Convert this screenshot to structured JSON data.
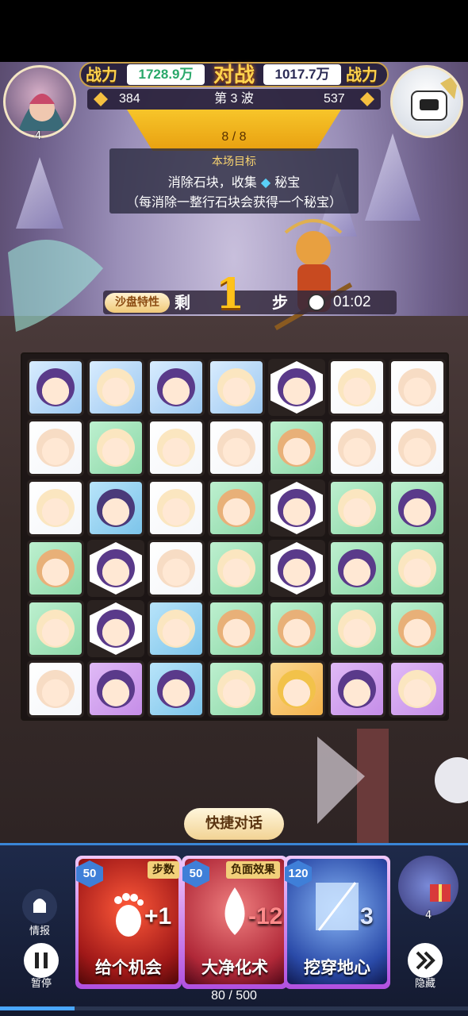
{
  "hud": {
    "power_label_left": "战力",
    "power_left": "1728.9万",
    "vs_label": "对战",
    "power_right": "1017.7万",
    "power_label_right": "战力",
    "gems_left": "384",
    "wave": "第 3 波",
    "gems_right": "537",
    "player_count": "4",
    "wave_progress": "8 / 8"
  },
  "goal": {
    "title": "本场目标",
    "line1": "消除石块，收集",
    "line1_suffix": "秘宝",
    "line2": "（每消除一整行石块会获得一个秘宝）"
  },
  "status": {
    "trait_button": "沙盘特性",
    "steps_left_label": "剩",
    "steps": "1",
    "steps_unit": "步",
    "timer": "01:02"
  },
  "board": {
    "rows": 6,
    "cols": 7,
    "tiles": [
      [
        "ice-purple",
        "ice-cat",
        "ice-purple",
        "ice-cat",
        "hex-purple",
        "white-cat",
        "white-monk"
      ],
      [
        "white-monk",
        "green-cat",
        "white-cat",
        "white-monk",
        "green-monkey",
        "white-monk",
        "white-monk"
      ],
      [
        "white-cat",
        "blue-purple-hood",
        "white-cat",
        "green-monkey",
        "hex-purple",
        "green-cat",
        "green-leaf-girl"
      ],
      [
        "green-monkey",
        "hex-purple",
        "white-monk",
        "green-cat",
        "hex-purple",
        "green-leaf-girl",
        "green-cat"
      ],
      [
        "green-cat",
        "hex-purple",
        "blue-lilac-cat",
        "green-monkey",
        "green-monkey",
        "green-cat",
        "green-monkey"
      ],
      [
        "white-monk",
        "purple-flower-girl",
        "blue-flower-girl",
        "green-cat",
        "orange-king",
        "purple-flower-girl",
        "purple-turtle-cat"
      ]
    ]
  },
  "chat": {
    "quick_chat": "快捷对话"
  },
  "cards": [
    {
      "cost": "50",
      "tag": "步数",
      "name": "给个机会",
      "value": "+1"
    },
    {
      "cost": "50",
      "tag": "负面效果",
      "name": "大净化术",
      "value": "-12"
    },
    {
      "cost": "120",
      "tag": "",
      "name": "挖穿地心",
      "value": "3"
    }
  ],
  "controls": {
    "info_label": "情报",
    "pause_label": "暂停",
    "hide_label": "隐藏",
    "gift_count": "4",
    "energy": "80 / 500",
    "energy_fraction": 0.16
  },
  "colors": {
    "gold": "#ffd34d",
    "green_power": "#2aa86a",
    "navy_power": "#2b2b55",
    "ice": "#9cc8f0",
    "green_tile": "#8cd8a8",
    "white_tile": "#f4f6fa",
    "purple_tile": "#c58de8",
    "blue_tile": "#7cc4ea"
  }
}
